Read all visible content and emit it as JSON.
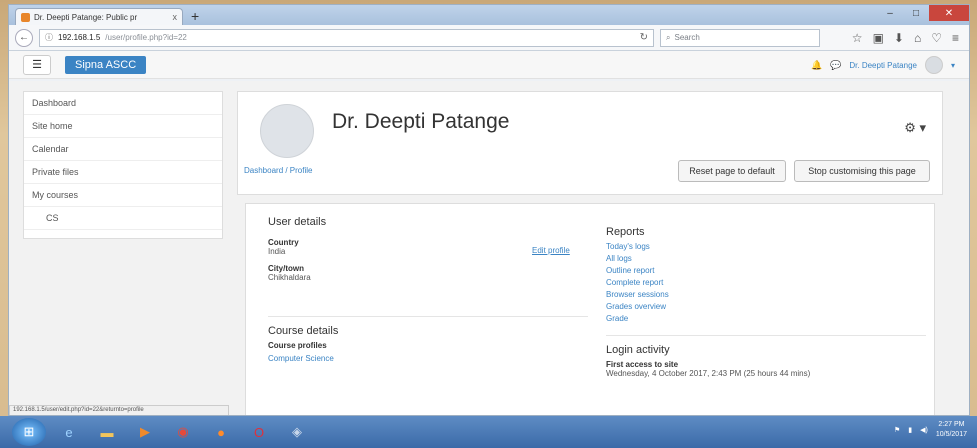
{
  "browser": {
    "tab_title": "Dr. Deepti Patange: Public pr",
    "tab_close": "x",
    "new_tab": "+",
    "url_host": "192.168.1.5",
    "url_path": "/user/profile.php?id=22",
    "search_placeholder": "Search",
    "status_url": "192.168.1.5/user/edit.php?id=22&returnto=profile"
  },
  "header": {
    "menu_icon": "☰",
    "brand": "Sipna ASCC",
    "user_name": "Dr. Deepti Patange",
    "bell": "🔔",
    "chat": "💬"
  },
  "sidebar": {
    "items": [
      {
        "label": "Dashboard"
      },
      {
        "label": "Site home"
      },
      {
        "label": "Calendar"
      },
      {
        "label": "Private files"
      },
      {
        "label": "My courses"
      },
      {
        "label": "CS"
      }
    ]
  },
  "profile": {
    "name": "Dr. Deepti Patange",
    "breadcrumb": "Dashboard / Profile",
    "reset_label": "Reset page to default",
    "stop_label": "Stop customising this page"
  },
  "user_details": {
    "title": "User details",
    "edit_link": "Edit profile",
    "country_label": "Country",
    "country_value": "India",
    "city_label": "City/town",
    "city_value": "Chikhaldara"
  },
  "course_details": {
    "title": "Course details",
    "profiles_label": "Course profiles",
    "course": "Computer Science"
  },
  "reports": {
    "title": "Reports",
    "links": [
      "Today's logs",
      "All logs",
      "Outline report",
      "Complete report",
      "Browser sessions",
      "Grades overview",
      "Grade"
    ]
  },
  "login_activity": {
    "title": "Login activity",
    "first_label": "First access to site",
    "first_value": "Wednesday, 4 October 2017, 2:43 PM  (25 hours 44 mins)"
  },
  "taskbar": {
    "time": "2:27 PM",
    "date": "10/5/2017"
  }
}
